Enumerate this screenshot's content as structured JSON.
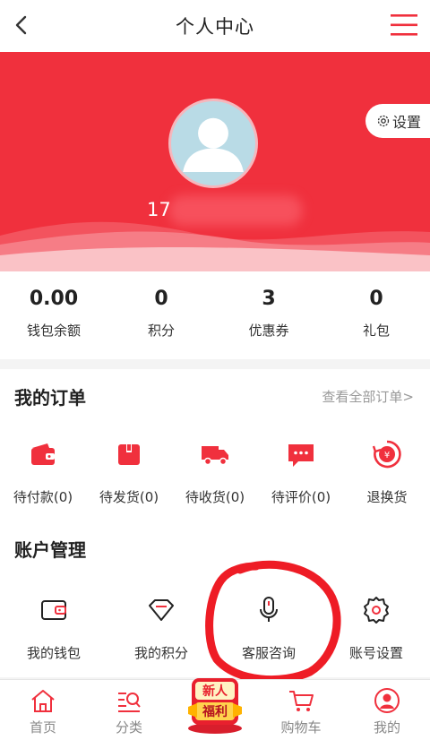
{
  "topbar": {
    "title": "个人中心",
    "back_icon": "chevron-left-icon",
    "menu_icon": "hamburger-menu-icon"
  },
  "profile": {
    "username": "17",
    "settings_label": "设置"
  },
  "stats": [
    {
      "value": "0.00",
      "label": "钱包余额"
    },
    {
      "value": "0",
      "label": "积分"
    },
    {
      "value": "3",
      "label": "优惠券"
    },
    {
      "value": "0",
      "label": "礼包"
    }
  ],
  "orders": {
    "title": "我的订单",
    "view_all": "查看全部订单>",
    "items": [
      {
        "label": "待付款(0)",
        "icon": "wallet-icon"
      },
      {
        "label": "待发货(0)",
        "icon": "package-icon"
      },
      {
        "label": "待收货(0)",
        "icon": "truck-icon"
      },
      {
        "label": "待评价(0)",
        "icon": "comment-icon"
      },
      {
        "label": "退换货",
        "icon": "refund-icon"
      }
    ]
  },
  "account": {
    "title": "账户管理",
    "items": [
      {
        "label": "我的钱包",
        "icon": "wallet-outline-icon"
      },
      {
        "label": "我的积分",
        "icon": "diamond-icon"
      },
      {
        "label": "客服咨询",
        "icon": "microphone-icon"
      },
      {
        "label": "账号设置",
        "icon": "gear-icon"
      }
    ]
  },
  "tabbar": {
    "items": [
      {
        "label": "首页",
        "icon": "home-icon"
      },
      {
        "label": "分类",
        "icon": "category-search-icon"
      },
      {
        "label": "",
        "icon": "new-user-promo-icon",
        "promo_top": "新人",
        "promo_bottom": "福利"
      },
      {
        "label": "购物车",
        "icon": "cart-icon"
      },
      {
        "label": "我的",
        "icon": "user-icon"
      }
    ]
  },
  "colors": {
    "brand_red": "#f0303d",
    "text_dark": "#222222",
    "text_gray": "#999999"
  }
}
